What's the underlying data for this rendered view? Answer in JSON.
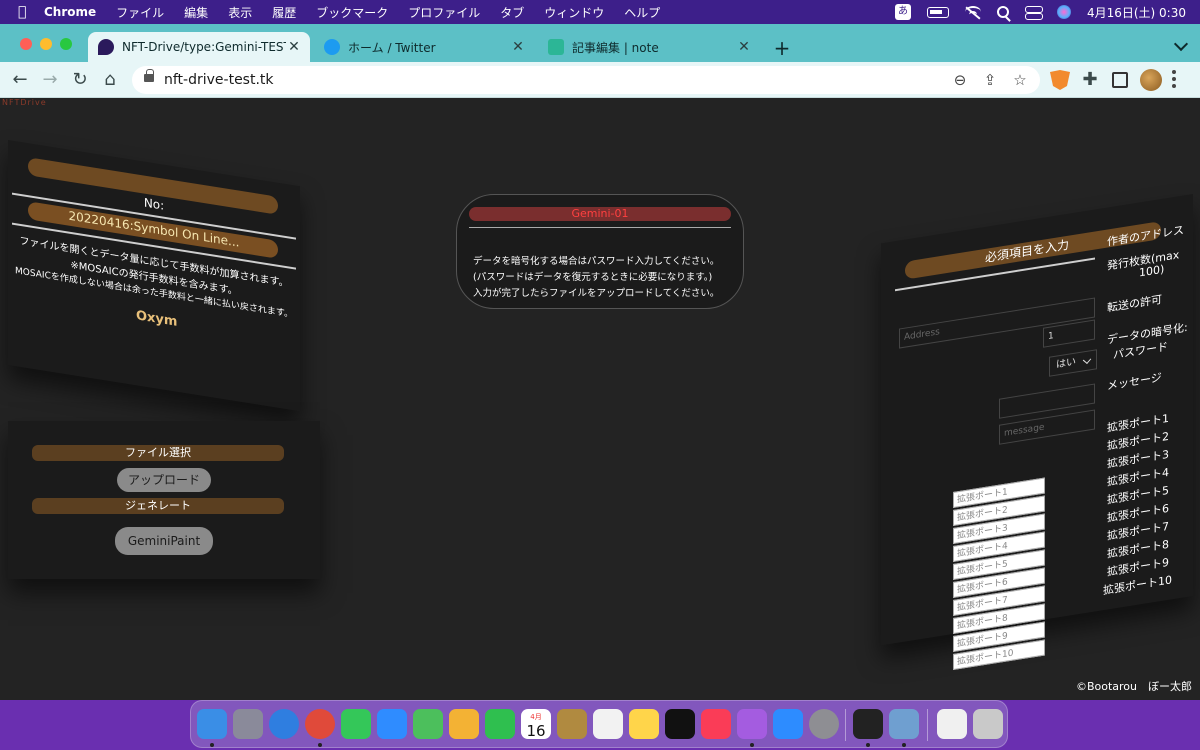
{
  "menubar": {
    "app_name": "Chrome",
    "items": [
      "ファイル",
      "編集",
      "表示",
      "履歴",
      "ブックマーク",
      "プロファイル",
      "タブ",
      "ウィンドウ",
      "ヘルプ"
    ],
    "ime": "あ",
    "clock": "4月16日(土)  0:30"
  },
  "tabs": [
    {
      "title": "NFT-Drive/type:Gemini-TEST_|",
      "favicon": "nft-drive-icon",
      "color": "#2b1a5c",
      "active": true
    },
    {
      "title": "ホーム / Twitter",
      "favicon": "twitter-bird-icon",
      "color": "#1d9bf0",
      "active": false
    },
    {
      "title": "記事編集 | note",
      "favicon": "note-icon",
      "color": "#2cb696",
      "active": false
    }
  ],
  "toolbar": {
    "url": "nft-drive-test.tk"
  },
  "page": {
    "brand": "NFTDrive",
    "copyright": "©Bootarou　ぼー太郎",
    "left_panel": {
      "no_label": "No:",
      "name": "20220416:Symbol On Line...",
      "info_lines": [
        "ファイルを開くとデータ量に応じて手数料が加算されます。",
        "※MOSAICの発行手数料を含みます。",
        "MOSAICを作成しない場合は余った手数料と一緒に払い戻されます。"
      ],
      "logo": "Oxym"
    },
    "file_panel": {
      "select_label": "ファイル選択",
      "upload_button": "アップロード",
      "generate_label": "ジェネレート",
      "paint_button": "GeminiPaint"
    },
    "center_panel": {
      "title": "Gemini-01",
      "lines": [
        "データを暗号化する場合はパスワード入力してください。",
        "(パスワードはデータを復元するときに必要になります。)",
        "入力が完了したらファイルをアップロードしてください。"
      ]
    },
    "right_panel": {
      "title": "必須項目を入力",
      "labels": {
        "author_address": "作者のアドレス",
        "mint_count": "発行枚数(max",
        "mint_count_2": "100)",
        "transfer": "転送の許可",
        "encrypt": "データの暗号化:",
        "password": "パスワード",
        "message": "メッセージ"
      },
      "address_placeholder": "Address",
      "mint_count_value": "1",
      "transfer_value": "はい",
      "message_placeholder": "message",
      "port_labels": [
        "拡張ポート1",
        "拡張ポート2",
        "拡張ポート3",
        "拡張ポート4",
        "拡張ポート5",
        "拡張ポート6",
        "拡張ポート7",
        "拡張ポート8",
        "拡張ポート9",
        "拡張ポート10"
      ],
      "port_placeholders": [
        "拡張ポート1",
        "拡張ポート2",
        "拡張ポート3",
        "拡張ポート4",
        "拡張ポート5",
        "拡張ポート6",
        "拡張ポート7",
        "拡張ポート8",
        "拡張ポート9",
        "拡張ポート10"
      ]
    }
  },
  "dock": {
    "calendar_month": "4月",
    "calendar_day": "16",
    "apps": [
      {
        "name": "finder",
        "color": "#3a8ee6"
      },
      {
        "name": "launchpad",
        "color": "#8a8a9a"
      },
      {
        "name": "safari",
        "color": "#2f7ee0"
      },
      {
        "name": "chrome",
        "color": "#e04a3a"
      },
      {
        "name": "messages",
        "color": "#34c759"
      },
      {
        "name": "mail",
        "color": "#2f8cff"
      },
      {
        "name": "maps",
        "color": "#4cbf5c"
      },
      {
        "name": "photos",
        "color": "#f3b234"
      },
      {
        "name": "facetime",
        "color": "#2fbf4f"
      },
      {
        "name": "calendar",
        "color": "#ffffff"
      },
      {
        "name": "symbol-wallet",
        "color": "#b08a40"
      },
      {
        "name": "reminders",
        "color": "#f2f2f2"
      },
      {
        "name": "notes",
        "color": "#ffd54a"
      },
      {
        "name": "apple-tv",
        "color": "#111111"
      },
      {
        "name": "music",
        "color": "#fa3c57"
      },
      {
        "name": "podcasts",
        "color": "#a45ce0"
      },
      {
        "name": "app-store",
        "color": "#2d8cff"
      },
      {
        "name": "system-preferences",
        "color": "#8e8e93"
      },
      {
        "name": "piano",
        "color": "#222222"
      },
      {
        "name": "preview",
        "color": "#6f9fd0"
      },
      {
        "name": "text-document",
        "color": "#f0f0f0"
      },
      {
        "name": "trash",
        "color": "#c9c9c9"
      }
    ]
  }
}
